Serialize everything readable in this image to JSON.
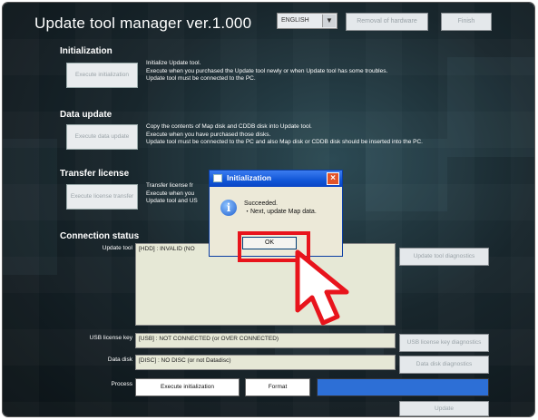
{
  "window": {
    "title": "Update tool manager ver.1.000",
    "language": "ENGLISH",
    "removal_label": "Removal of hardware",
    "finish_label": "Finish"
  },
  "initialization": {
    "heading": "Initialization",
    "button": "Execute initialization",
    "desc1": "Initialize Update tool.",
    "desc2": "Execute when you purchased the Update tool newly or when Update tool has some troubles.",
    "desc3": "Update tool must be connected to the PC."
  },
  "data_update": {
    "heading": "Data update",
    "button": "Execute data update",
    "desc1": "Copy the contents of Map disk and CDDB disk into Update tool.",
    "desc2": "Execute when you have purchased those disks.",
    "desc3": "Update tool must be connected to the PC and also Map disk or CDDB disk should be inserted into the PC."
  },
  "transfer_license": {
    "heading": "Transfer license",
    "button": "Execute license transfer",
    "desc1": "Transfer license fr",
    "desc2": "Execute when you",
    "desc3": "Update tool and US"
  },
  "connection": {
    "heading": "Connection status",
    "update_tool_label": "Update tool",
    "update_tool_value": "[HDD] : INVALID (NO",
    "update_tool_diag": "Update tool diagnostics",
    "usb_label": "USB license key",
    "usb_value": "[USB] : NOT CONNECTED (or OVER CONNECTED)",
    "usb_diag": "USB license key diagnostics",
    "disk_label": "Data disk",
    "disk_value": "[DISC] : NO DISC (or not Datadisc)",
    "disk_diag": "Data disk diagnostics",
    "process_label": "Process",
    "process_value": "Execute initialization",
    "format_label": "Format",
    "update_label": "Update"
  },
  "dialog": {
    "title": "Initialization",
    "line1": "Succeeded.",
    "line2": "・Next, update Map data.",
    "ok": "OK",
    "info_icon": "info-icon",
    "close_icon": "close-icon"
  },
  "colors": {
    "highlight": "#e8141c",
    "progress": "#2d6fd6",
    "titlebar": "#1156d7"
  }
}
